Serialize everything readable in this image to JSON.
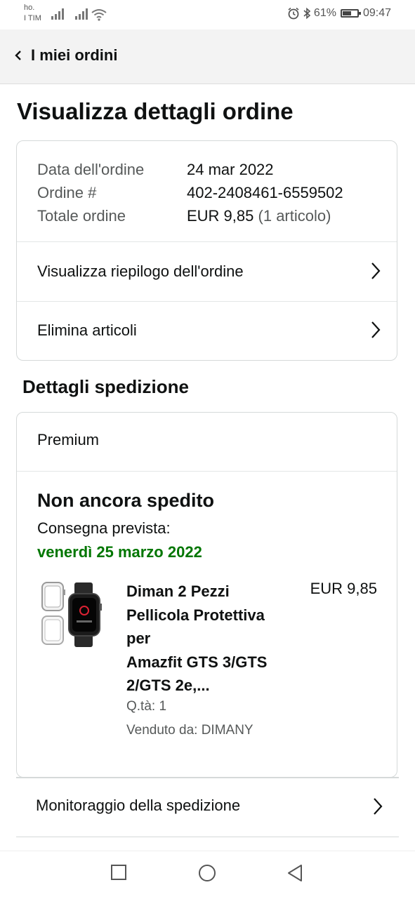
{
  "status_bar": {
    "carrier_line1": "ho.",
    "carrier_line2": "I TIM",
    "battery_percent": "61%",
    "battery_level": 0.61,
    "time": "09:47",
    "icons": [
      "signal-icon",
      "wifi-icon",
      "alarm-icon",
      "bluetooth-icon",
      "battery-icon"
    ]
  },
  "header": {
    "back_label": "I miei ordini"
  },
  "page_title": "Visualizza dettagli ordine",
  "order": {
    "date_label": "Data dell'ordine",
    "date_value": "24 mar 2022",
    "number_label": "Ordine #",
    "number_value": "402-2408461-6559502",
    "total_label": "Totale ordine",
    "total_value": "EUR 9,85",
    "total_items": "(1 articolo)"
  },
  "actions": {
    "summary_label": "Visualizza riepilogo dell'ordine",
    "delete_label": "Elimina articoli"
  },
  "shipping": {
    "section_title": "Dettagli spedizione",
    "service": "Premium",
    "status": "Non ancora spedito",
    "delivery_label": "Consegna prevista:",
    "delivery_date": "venerdì 25 marzo 2022",
    "item": {
      "title_lines": [
        "Diman 2 Pezzi",
        "Pellicola Protettiva",
        "per",
        "Amazfit GTS 3/GTS",
        "2/GTS 2e,..."
      ],
      "price": "EUR 9,85",
      "quantity": "Q.tà: 1",
      "seller": "Venduto da: DIMANY"
    },
    "tracking_label": "Monitoraggio della spedizione"
  },
  "colors": {
    "delivery_green": "#007600",
    "header_bg": "#f3f3f3",
    "border": "#d5d9d9"
  }
}
